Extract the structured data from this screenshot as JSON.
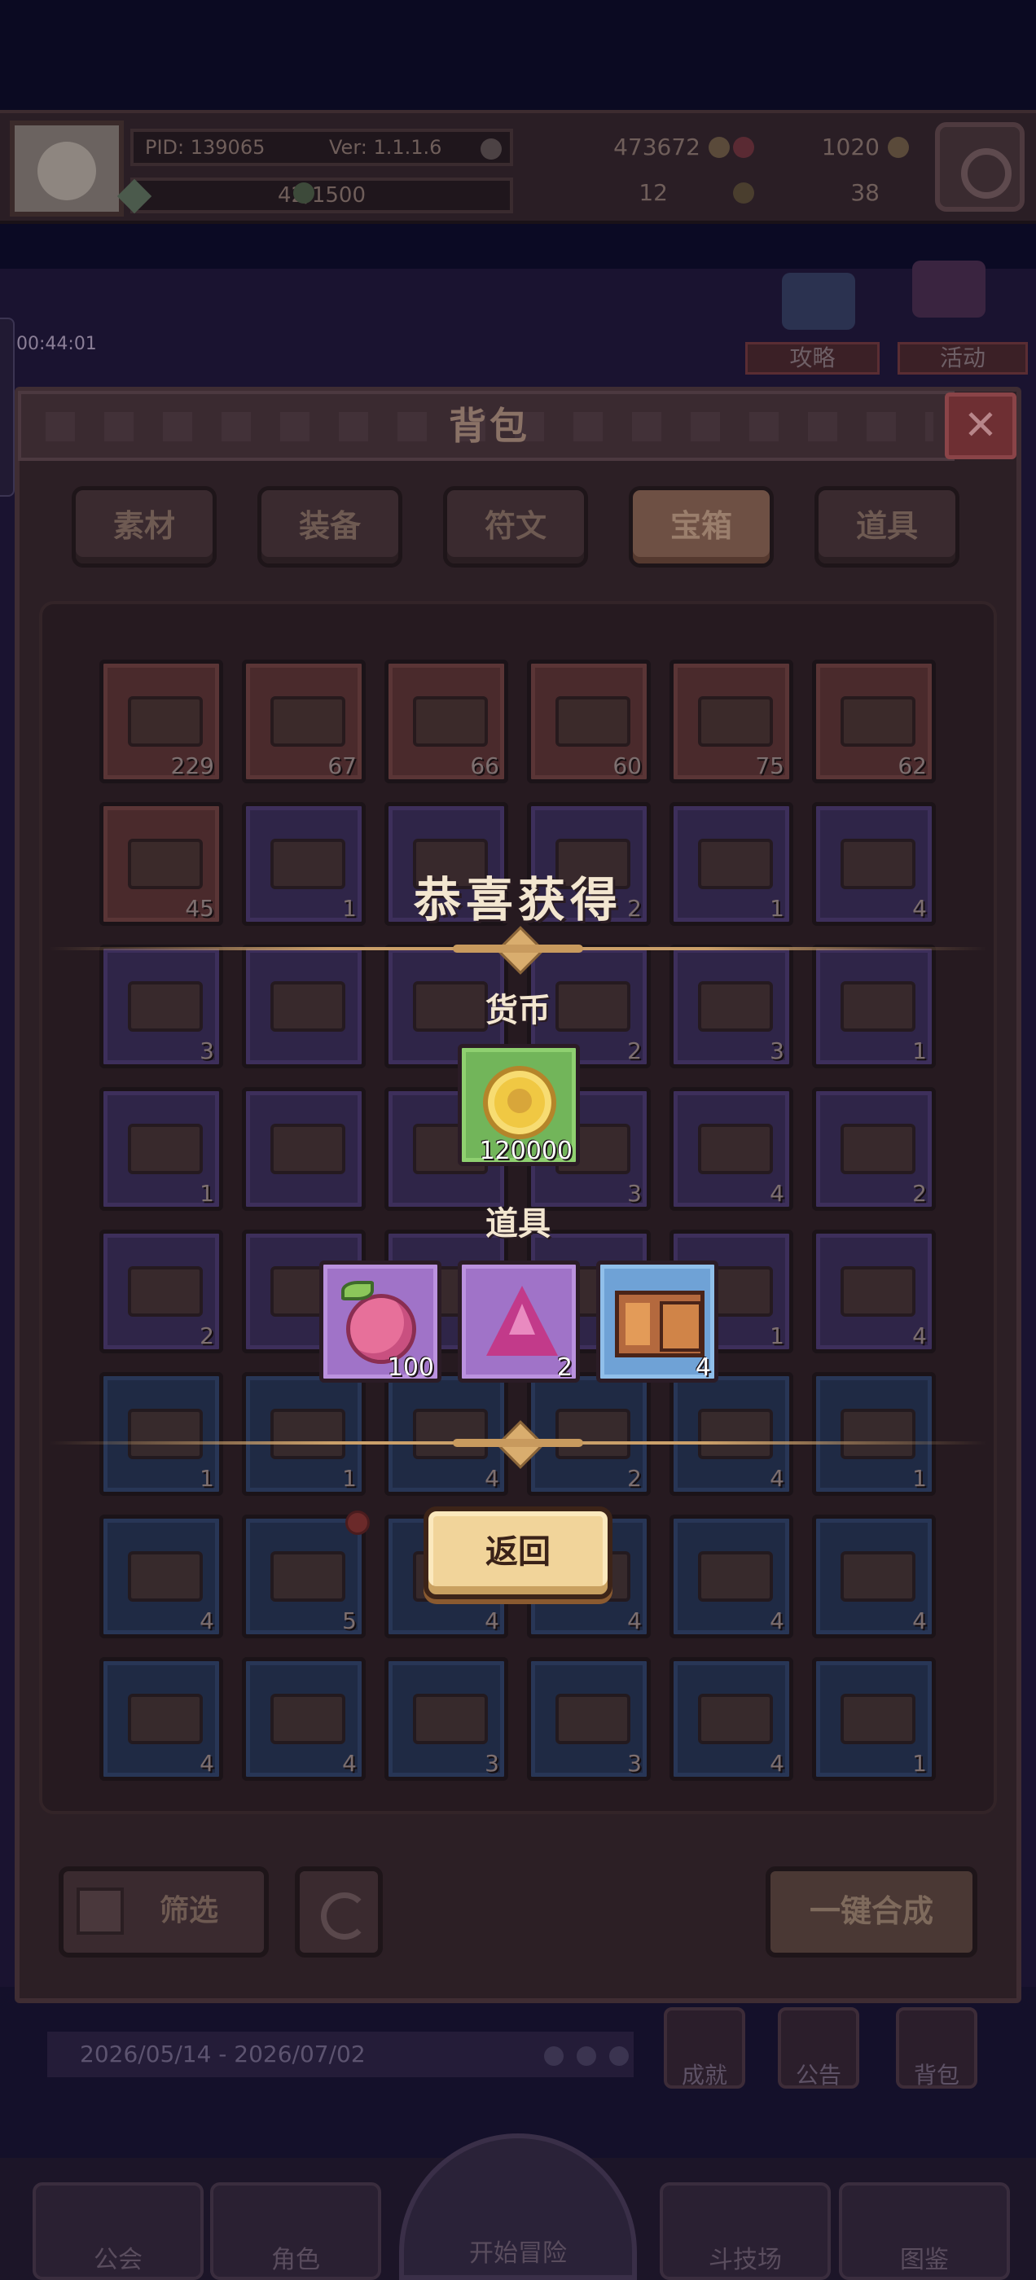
{
  "header": {
    "pid": "PID: 139065",
    "version": "Ver: 1.1.1.6",
    "exp": "42/1500",
    "gold": "473672",
    "gems": "1020",
    "clover": "12",
    "keys": "38"
  },
  "event": {
    "timer": "00:44:01",
    "guide_label": "攻略",
    "activity_label": "活动",
    "date_range": "2026/05/14 - 2026/07/02"
  },
  "side_buttons": {
    "achievement": "成就",
    "notice": "公告",
    "bag": "背包"
  },
  "nav": {
    "guild": "公会",
    "character": "角色",
    "start": "开始冒险",
    "arena": "斗技场",
    "codex": "图鉴"
  },
  "bag": {
    "title": "背包",
    "close": "✕",
    "tabs": [
      {
        "label": "素材",
        "active": false
      },
      {
        "label": "装备",
        "active": false
      },
      {
        "label": "符文",
        "active": false
      },
      {
        "label": "宝箱",
        "active": true
      },
      {
        "label": "道具",
        "active": false
      }
    ],
    "slots": [
      {
        "rarity": "r",
        "count": "229"
      },
      {
        "rarity": "r",
        "count": "67"
      },
      {
        "rarity": "r",
        "count": "66"
      },
      {
        "rarity": "r",
        "count": "60"
      },
      {
        "rarity": "r",
        "count": "75"
      },
      {
        "rarity": "r",
        "count": "62"
      },
      {
        "rarity": "r",
        "count": "45"
      },
      {
        "rarity": "p",
        "count": "1"
      },
      {
        "rarity": "p",
        "count": ""
      },
      {
        "rarity": "p",
        "count": "2"
      },
      {
        "rarity": "p",
        "count": "1"
      },
      {
        "rarity": "p",
        "count": "4"
      },
      {
        "rarity": "p",
        "count": "3"
      },
      {
        "rarity": "p",
        "count": ""
      },
      {
        "rarity": "p",
        "count": ""
      },
      {
        "rarity": "p",
        "count": "2"
      },
      {
        "rarity": "p",
        "count": "3"
      },
      {
        "rarity": "p",
        "count": "1"
      },
      {
        "rarity": "p",
        "count": "1"
      },
      {
        "rarity": "p",
        "count": ""
      },
      {
        "rarity": "p",
        "count": ""
      },
      {
        "rarity": "p",
        "count": "3"
      },
      {
        "rarity": "p",
        "count": "4"
      },
      {
        "rarity": "p",
        "count": "2"
      },
      {
        "rarity": "p",
        "count": "2"
      },
      {
        "rarity": "p",
        "count": ""
      },
      {
        "rarity": "p",
        "count": ""
      },
      {
        "rarity": "p",
        "count": ""
      },
      {
        "rarity": "p",
        "count": "1"
      },
      {
        "rarity": "p",
        "count": "4"
      },
      {
        "rarity": "b",
        "count": "1"
      },
      {
        "rarity": "b",
        "count": "1"
      },
      {
        "rarity": "b",
        "count": "4"
      },
      {
        "rarity": "b",
        "count": "2"
      },
      {
        "rarity": "b",
        "count": "4"
      },
      {
        "rarity": "b",
        "count": "1"
      },
      {
        "rarity": "b",
        "count": "4"
      },
      {
        "rarity": "b",
        "count": "5"
      },
      {
        "rarity": "b",
        "count": "4"
      },
      {
        "rarity": "b",
        "count": "4"
      },
      {
        "rarity": "b",
        "count": "4"
      },
      {
        "rarity": "b",
        "count": "4"
      },
      {
        "rarity": "b",
        "count": "4"
      },
      {
        "rarity": "b",
        "count": "4"
      },
      {
        "rarity": "b",
        "count": "3"
      },
      {
        "rarity": "b",
        "count": "3"
      },
      {
        "rarity": "b",
        "count": "4"
      },
      {
        "rarity": "b",
        "count": "1"
      }
    ],
    "filter_label": "筛选",
    "merge_label": "一键合成"
  },
  "reward": {
    "title": "恭喜获得",
    "currency_label": "货币",
    "items_label": "道具",
    "currency": [
      {
        "icon": "gold-coin-icon",
        "qty": "120000"
      }
    ],
    "items": [
      {
        "icon": "fruit-icon",
        "qty": "100"
      },
      {
        "icon": "crystal-icon",
        "qty": "2"
      },
      {
        "icon": "chest-icon",
        "qty": "4"
      }
    ],
    "return_label": "返回"
  }
}
